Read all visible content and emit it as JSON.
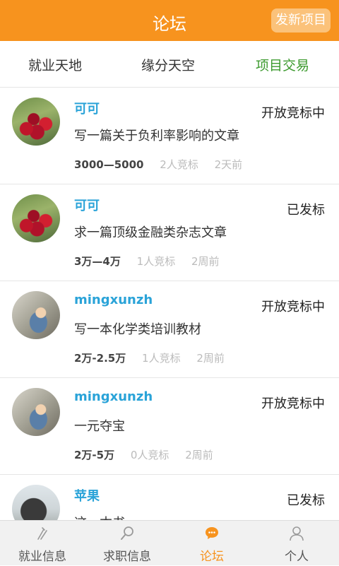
{
  "header": {
    "title": "论坛",
    "new_button": "发新项目"
  },
  "tabs": [
    {
      "label": "就业天地"
    },
    {
      "label": "缘分天空"
    },
    {
      "label": "项目交易"
    }
  ],
  "posts": [
    {
      "user": "可可",
      "status": "开放竞标中",
      "subject": "写一篇关于负利率影响的文章",
      "price": "3000—5000",
      "bids": "2人竞标",
      "time": "2天前"
    },
    {
      "user": "可可",
      "status": "已发标",
      "subject": "求一篇顶级金融类杂志文章",
      "price": "3万—4万",
      "bids": "1人竞标",
      "time": "2周前"
    },
    {
      "user": "mingxunzh",
      "status": "开放竞标中",
      "subject": "写一本化学类培训教材",
      "price": "2万-2.5万",
      "bids": "1人竞标",
      "time": "2周前"
    },
    {
      "user": "mingxunzh",
      "status": "开放竞标中",
      "subject": "一元夺宝",
      "price": "2万-5万",
      "bids": "0人竞标",
      "time": "2周前"
    },
    {
      "user": "苹果",
      "status": "已发标",
      "subject": "这一本书",
      "price": "",
      "bids": "",
      "time": ""
    }
  ],
  "bottom_nav": [
    {
      "label": "就业信息",
      "icon": "job-icon"
    },
    {
      "label": "求职信息",
      "icon": "search-icon"
    },
    {
      "label": "论坛",
      "icon": "chat-bubble-icon"
    },
    {
      "label": "个人",
      "icon": "person-icon"
    }
  ],
  "colors": {
    "accent": "#f7931e",
    "active_tab": "#3c9a2e",
    "username": "#2aa3d8"
  }
}
